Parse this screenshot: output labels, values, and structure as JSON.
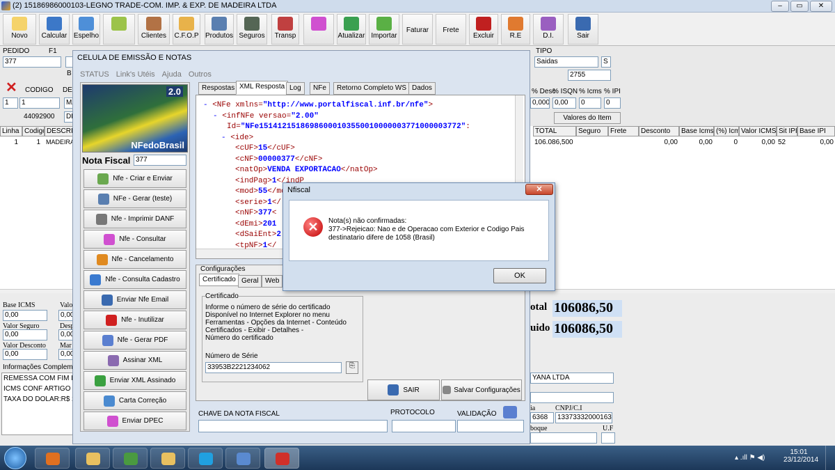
{
  "window": {
    "title": "(2) 15186986000103-LEGNO TRADE-COM. IMP. & EXP. DE MADEIRA LTDA",
    "min": "–",
    "max": "▭",
    "close": "✕"
  },
  "toolbar": [
    {
      "label": "Novo",
      "icon": "new-icon",
      "color": "#f5d36b"
    },
    {
      "label": "Calcular",
      "icon": "calculator-icon",
      "color": "#3c78c8"
    },
    {
      "label": "Espelho",
      "icon": "mirror-icon",
      "color": "#4e8fd8"
    },
    {
      "label": "",
      "icon": "internet-icon",
      "color": "#9cc34a"
    },
    {
      "label": "Clientes",
      "icon": "clients-icon",
      "color": "#b27245"
    },
    {
      "label": "C.F.O.P",
      "icon": "folder-icon",
      "color": "#e8b24a"
    },
    {
      "label": "Produtos",
      "icon": "products-icon",
      "color": "#5a7fb0"
    },
    {
      "label": "Seguros",
      "icon": "insurance-icon",
      "color": "#556655"
    },
    {
      "label": "Transp",
      "icon": "truck-icon",
      "color": "#c04040"
    },
    {
      "label": "",
      "icon": "add-icon",
      "color": "#d050d0"
    },
    {
      "label": "Atualizar",
      "icon": "refresh-icon",
      "color": "#3aa050"
    },
    {
      "label": "Importar",
      "icon": "import-icon",
      "color": "#5ab045"
    },
    {
      "label": "Faturar",
      "icon": "",
      "color": ""
    },
    {
      "label": "Frete",
      "icon": "",
      "color": ""
    },
    {
      "label": "Excluir",
      "icon": "delete-icon",
      "color": "#c02020"
    },
    {
      "label": "R.E",
      "icon": "re-icon",
      "color": "#e07a30"
    },
    {
      "label": "D.I.",
      "icon": "di-icon",
      "color": "#9a5fc0"
    },
    {
      "label": "Sair",
      "icon": "exit-icon",
      "color": "#3a6ab0"
    }
  ],
  "form": {
    "pedido_label": "PEDIDO",
    "f1_label": "F1",
    "pedido_value": "377",
    "b_label": "B",
    "codigo_label": "CODIGO",
    "de_label": "DE",
    "codigo_value": "1",
    "codigo2_value": "1",
    "ma_value": "MA",
    "num_value": "44092900",
    "de_value": "DE",
    "tipo_label": "TIPO",
    "tipo_value": "Saidas",
    "s_value": "S",
    "num2_value": "2755",
    "desc_label": "% Desc",
    "isqn_label": "% ISQN",
    "icms_label": "% Icms",
    "ipi_label": "% IPI",
    "desc_value": "0,000",
    "isqn_value": "0,00",
    "icms_value": "0",
    "ipi_value": "0",
    "valores_button": "Valores do Item"
  },
  "grid": {
    "headers_left": [
      "Linha",
      "Codigo",
      "DESCRI"
    ],
    "headers_right": [
      "TOTAL",
      "Seguro",
      "Frete",
      "Desconto",
      "Base Icms",
      "(%) Icms",
      "Valor ICMS",
      "Sit IPI",
      "Base IPI"
    ],
    "row_left": [
      "1",
      "1",
      "MADEIRA"
    ],
    "row_right": [
      "106.086,500",
      "",
      "",
      "0,00",
      "0,00",
      "0",
      "0,00",
      "52",
      "0,00"
    ]
  },
  "bottom": {
    "base_icms_label": "Base ICMS",
    "base_icms_value": "0,00",
    "valo_label": "Valo",
    "valo_value": "0,00",
    "valor_seguro_label": "Valor Seguro",
    "valor_seguro_value": "0,00",
    "desp_label": "Desp",
    "desp_value": "0,00",
    "valor_desconto_label": "Valor Desconto",
    "valor_desconto_value": "0,00",
    "mar_label": "Mar",
    "mar_value": "0,00",
    "info_label": "Informações Complemer",
    "info_lines": [
      "REMESSA COM FIM ES",
      "ICMS CONF ARTIGO 3",
      "TAXA DO DOLAR:R$ 2"
    ],
    "total_label": "otal",
    "total_value": "106086,50",
    "liquido_label": "uido",
    "liquido_value": "106086,50",
    "transp_value": "YANA LTDA",
    "ia_label": "ia",
    "cnpj_label": "CNPJ/C.I",
    "cnpj_prefix": "6368",
    "cnpj_value": "13373332000163",
    "boque_label": "boque",
    "uf_label": "U.F"
  },
  "dialog": {
    "title": "CELULA DE EMISSÃO E NOTAS",
    "menu": [
      "STATUS",
      "Link's Utéis",
      "Ajuda",
      "Outros"
    ],
    "logo_version": "2.0",
    "logo_text": "NFedoBrasil",
    "nota_fiscal_label": "Nota Fiscal",
    "nota_fiscal_value": "377",
    "buttons": [
      {
        "label": "Nfe - Criar e Enviar",
        "icon": "create-send-icon",
        "color": "#6aa84f"
      },
      {
        "label": "NFe - Gerar (teste)",
        "icon": "printer-icon",
        "color": "#5a7fb0"
      },
      {
        "label": "Nfe - Imprimir DANF",
        "icon": "print-icon",
        "color": "#777777"
      },
      {
        "label": "Nfe - Consultar",
        "icon": "consult-icon",
        "color": "#d050d0"
      },
      {
        "label": "Nfe - Cancelamento",
        "icon": "cancel-icon",
        "color": "#e08a20"
      },
      {
        "label": "Nfe - Consulta Cadastro",
        "icon": "windows-icon",
        "color": "#3a7ad0"
      },
      {
        "label": "Enviar Nfe Email",
        "icon": "email-icon",
        "color": "#3a6ab0"
      },
      {
        "label": "Nfe - Inutilizar",
        "icon": "x-icon",
        "color": "#d02020"
      },
      {
        "label": "Nfe - Gerar PDF",
        "icon": "pdf-icon",
        "color": "#5a7fd0"
      },
      {
        "label": "Assinar XML",
        "icon": "sign-icon",
        "color": "#8a6ab0"
      },
      {
        "label": "Enviar XML Assinado",
        "icon": "up-arrow-icon",
        "color": "#3aa040"
      },
      {
        "label": "Carta Correção",
        "icon": "pencil-icon",
        "color": "#4a8ad0"
      },
      {
        "label": "Enviar DPEC",
        "icon": "dpec-icon",
        "color": "#d050d0"
      }
    ],
    "tabs": [
      "Respostas",
      "XML Resposta",
      "Log",
      "NFe",
      "Retorno Completo WS",
      "Dados"
    ],
    "xml": [
      {
        "prefix": "- ",
        "tag": "<NFe xmlns=",
        "val": "\"http://www.portalfiscal.inf.br/nfe\"",
        "suffix": ">"
      },
      {
        "prefix": "- ",
        "tag": "<infNFe versao=",
        "val": "\"2.00\"",
        "suffix": ""
      },
      {
        "prefix": "",
        "tag": "Id=",
        "val": "\"NFe15141215186986000103550010000003771000003772\"",
        "suffix": ":"
      },
      {
        "prefix": "- ",
        "tag": "<ide>",
        "val": "",
        "suffix": ""
      },
      {
        "prefix": "",
        "tag": "<cUF>",
        "val": "15",
        "suffix": "</cUF>"
      },
      {
        "prefix": "",
        "tag": "<cNF>",
        "val": "00000377",
        "suffix": "</cNF>"
      },
      {
        "prefix": "",
        "tag": "<natOp>",
        "val": "VENDA EXPORTACAO",
        "suffix": "</natOp>"
      },
      {
        "prefix": "",
        "tag": "<indPag>",
        "val": "1",
        "suffix": "</indP"
      },
      {
        "prefix": "",
        "tag": "<mod>",
        "val": "55",
        "suffix": "</mod"
      },
      {
        "prefix": "",
        "tag": "<serie>",
        "val": "1",
        "suffix": "</"
      },
      {
        "prefix": "",
        "tag": "<nNF>",
        "val": "377",
        "suffix": "<"
      },
      {
        "prefix": "",
        "tag": "<dEmi>",
        "val": "201",
        "suffix": ""
      },
      {
        "prefix": "",
        "tag": "<dSaiEnt>",
        "val": "2",
        "suffix": ""
      },
      {
        "prefix": "",
        "tag": "<tpNF>",
        "val": "1",
        "suffix": "</"
      }
    ],
    "config": {
      "group_label": "Configurações",
      "tabs": [
        "Certificado",
        "Geral",
        "Web"
      ],
      "cert_label": "Certificado",
      "info": "Informe o número de série do certificado\nDisponível no Internet Explorer no menu\nFerramentas - Opções da Internet - Conteúdo\nCertificados - Exibir - Detalhes -\nNúmero do certificado",
      "serie_label": "Número de Série",
      "serie_value": "33953B2221234062",
      "sair_button": "SAIR",
      "salvar_button": "Salvar Configurações"
    },
    "chave_label": "CHAVE DA NOTA FISCAL",
    "protocolo_label": "PROTOCOLO",
    "validacao_label": "VALIDAÇÃO"
  },
  "modal": {
    "title": "Nfiscal",
    "close": "✕",
    "line1": "Nota(s) não confirmadas:",
    "line2": "377->Rejeicao: Nao e de Operacao com Exterior e Codigo Pais",
    "line3": "destinatario difere de 1058 (Brasil)",
    "ok": "OK"
  },
  "taskbar": {
    "time": "15:01",
    "date": "23/12/2014",
    "apps": [
      {
        "icon": "media-player-icon",
        "color": "#e07020"
      },
      {
        "icon": "explorer-icon",
        "color": "#e8c060"
      },
      {
        "icon": "chrome-icon",
        "color": "#4a9a40"
      },
      {
        "icon": "folder-app-icon",
        "color": "#e8c060"
      },
      {
        "icon": "skype-icon",
        "color": "#20a0e0"
      },
      {
        "icon": "mail-icon",
        "color": "#5a8ad0"
      },
      {
        "icon": "nfe-app-icon",
        "color": "#d0302a"
      }
    ]
  }
}
